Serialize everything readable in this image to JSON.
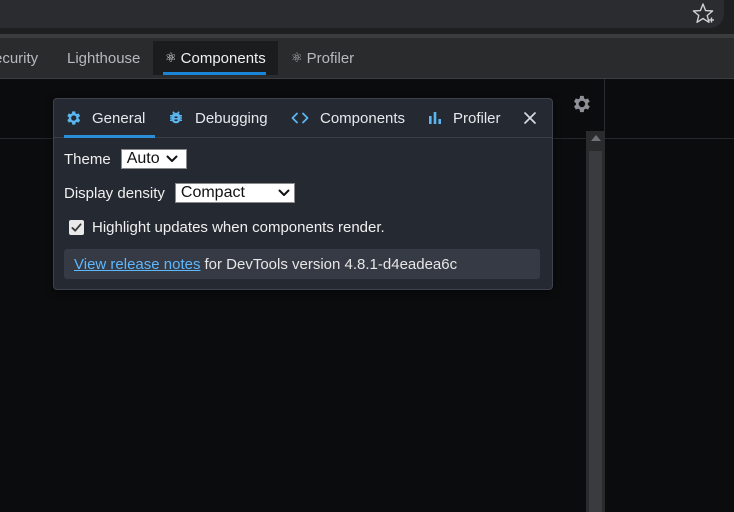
{
  "devtools_tabs": [
    {
      "label": "ecurity",
      "active": false
    },
    {
      "label": "Lighthouse",
      "active": false
    },
    {
      "label": "Components",
      "active": true,
      "icon": "react-atom-icon"
    },
    {
      "label": "Profiler",
      "active": false,
      "icon": "react-atom-icon"
    }
  ],
  "settings": {
    "tabs": [
      {
        "label": "General",
        "icon": "gear-icon",
        "active": true
      },
      {
        "label": "Debugging",
        "icon": "bug-icon",
        "active": false
      },
      {
        "label": "Components",
        "icon": "code-brackets-icon",
        "active": false
      },
      {
        "label": "Profiler",
        "icon": "bar-chart-icon",
        "active": false
      }
    ],
    "theme_label": "Theme",
    "theme_value": "Auto",
    "density_label": "Display density",
    "density_value": "Compact",
    "highlight_label": "Highlight updates when components render.",
    "highlight_checked": true,
    "release_link": "View release notes",
    "release_text": "for DevTools version 4.8.1-d4eadea6c"
  },
  "colors": {
    "accent": "#1a84d6",
    "link": "#5cb8ff",
    "icon_blue": "#5bb6f0",
    "modal_bg": "#252932"
  }
}
